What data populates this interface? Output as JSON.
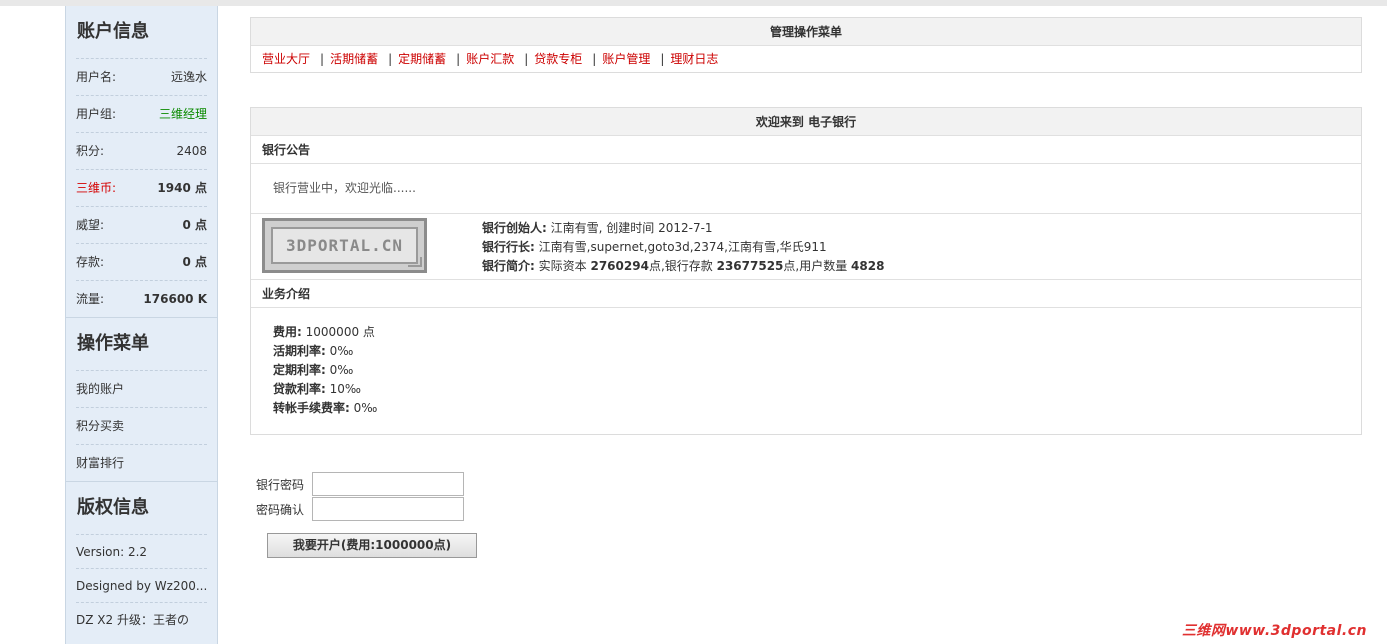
{
  "sidebar": {
    "account": {
      "title": "账户信息",
      "rows": [
        {
          "label": "用户名:",
          "value": "远逸水"
        },
        {
          "label": "用户组:",
          "value": "三维经理"
        },
        {
          "label": "积分:",
          "value": "2408"
        },
        {
          "label": "三维币:",
          "value": "1940 点"
        },
        {
          "label": "威望:",
          "value": "0 点"
        },
        {
          "label": "存款:",
          "value": "0 点"
        },
        {
          "label": "流量:",
          "value": "176600 K"
        }
      ]
    },
    "ops": {
      "title": "操作菜单",
      "items": [
        "我的账户",
        "积分买卖",
        "财富排行"
      ]
    },
    "copyright": {
      "title": "版权信息",
      "lines": [
        "Version: 2.2",
        "Designed by Wz200...",
        "DZ X2 升级：王者の"
      ]
    }
  },
  "menu": {
    "title": "管理操作菜单",
    "items": [
      "营业大厅",
      "活期储蓄",
      "定期储蓄",
      "账户汇款",
      "贷款专柜",
      "账户管理",
      "理财日志"
    ],
    "separator": "|"
  },
  "welcome": {
    "title": "欢迎来到 电子银行",
    "notice_head": "银行公告",
    "notice_text": "银行营业中，欢迎光临......",
    "logo_text": "3DPORTAL.CN",
    "founder_label": "银行创始人:",
    "founder_value": "江南有雪, 创建时间 2012-7-1",
    "president_label": "银行行长:",
    "president_value": "江南有雪,supernet,goto3d,2374,江南有雪,华氏911",
    "intro_label": "银行简介:",
    "intro_p1": "实际资本",
    "capital": "2760294",
    "intro_p2": "点,银行存款",
    "deposits": "23677525",
    "intro_p3": "点,用户数量",
    "users": "4828",
    "biz_head": "业务介绍",
    "fees": [
      {
        "label": "费用:",
        "value": "1000000 点"
      },
      {
        "label": "活期利率:",
        "value": "0‰"
      },
      {
        "label": "定期利率:",
        "value": "0‰"
      },
      {
        "label": "贷款利率:",
        "value": "10‰"
      },
      {
        "label": "转帐手续费率:",
        "value": "0‰"
      }
    ]
  },
  "form": {
    "password_label": "银行密码",
    "confirm_label": "密码确认",
    "password_value": "",
    "confirm_value": "",
    "submit_label": "我要开户(费用:1000000点)"
  },
  "watermark": "三维网www.3dportal.cn"
}
